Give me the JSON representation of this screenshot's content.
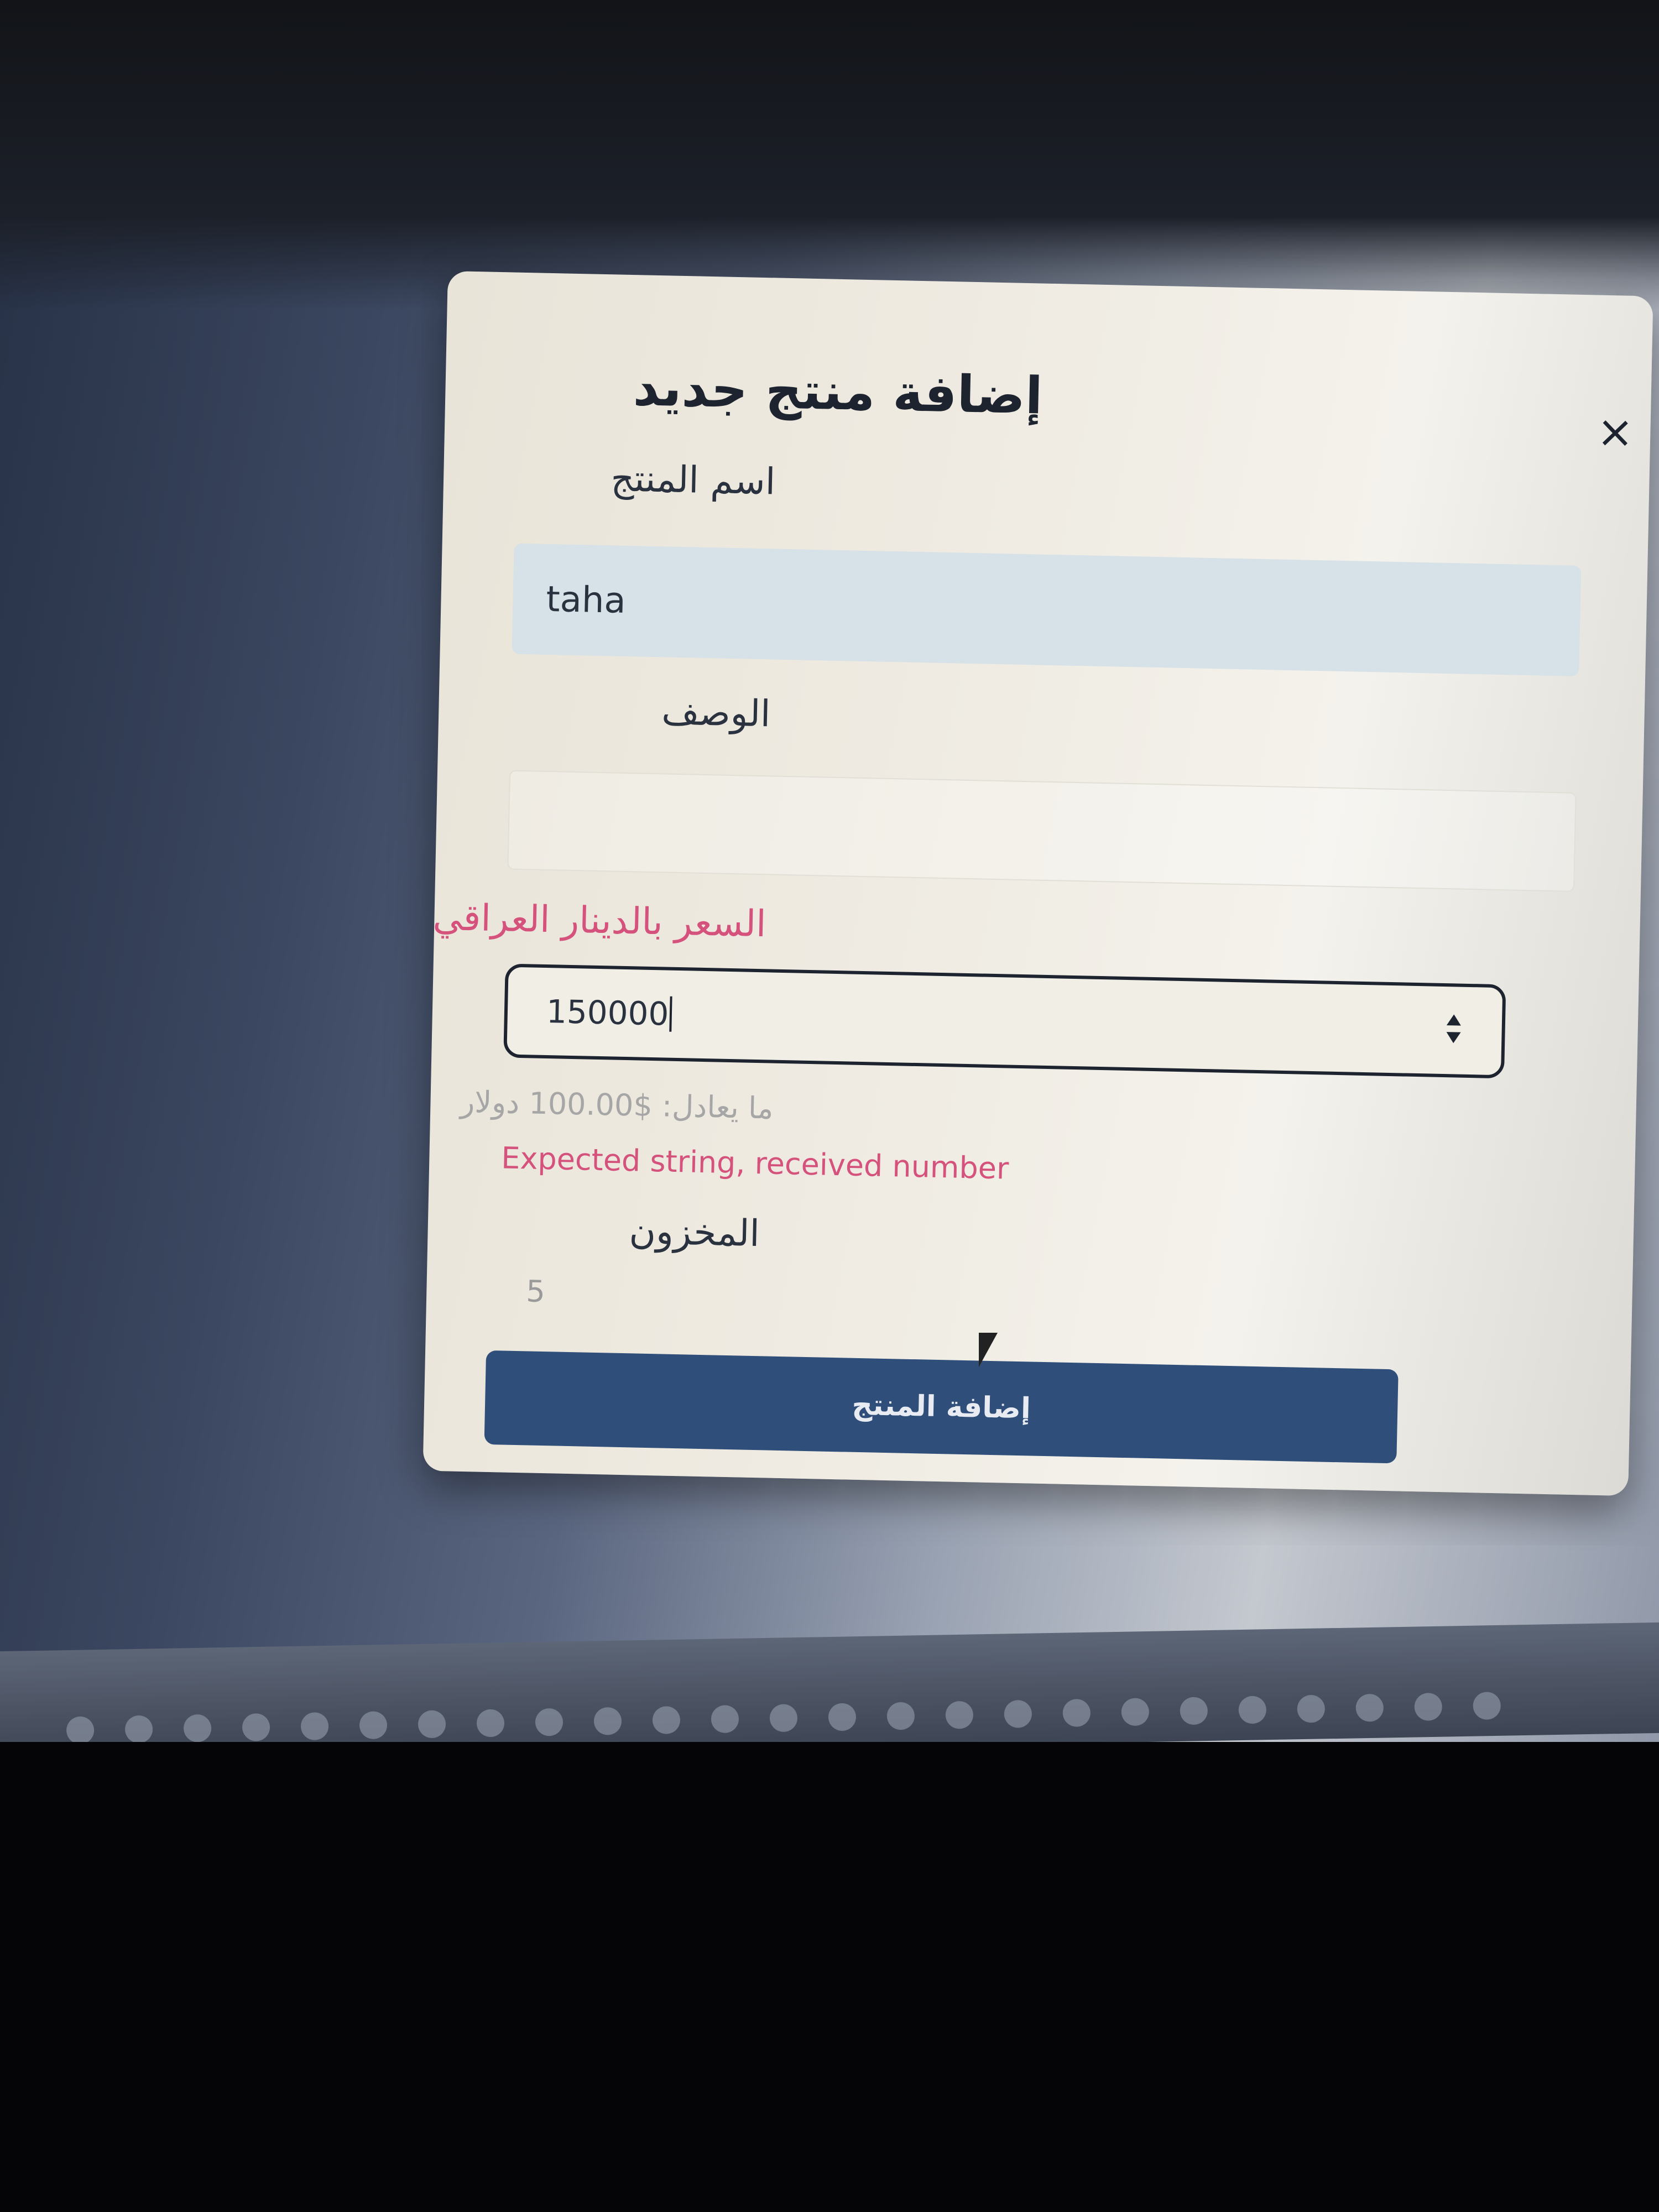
{
  "modal": {
    "title": "إضافة منتج جديد",
    "close_label": "×"
  },
  "form": {
    "name_label": "اسم المنتج",
    "name_value": "taha",
    "description_label": "الوصف",
    "description_value": "",
    "price_label": "السعر بالدينار العراقي",
    "price_value": "150000",
    "price_equivalent": "ما يعادل: $100.00 دولار",
    "price_error": "Expected string, received number",
    "stock_label": "المخزون",
    "stock_value": "5",
    "submit_label": "إضافة المنتج"
  },
  "colors": {
    "error": "#d5527d",
    "submit_bg": "#2f4f7a",
    "name_input_bg": "#d6e1e8"
  }
}
